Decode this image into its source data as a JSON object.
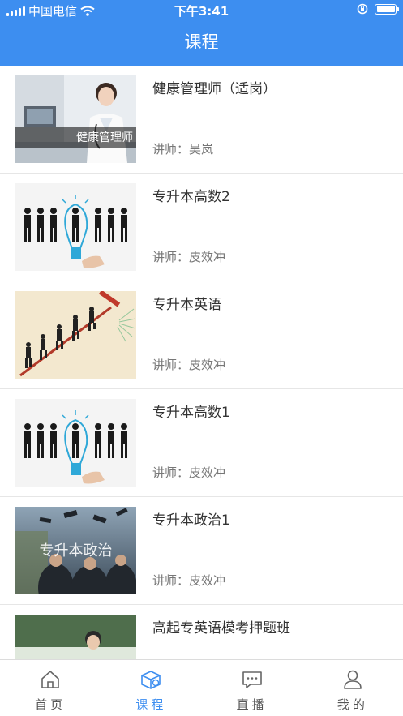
{
  "status_bar": {
    "carrier": "中国电信",
    "time": "下午3:41"
  },
  "header": {
    "title": "课程"
  },
  "courses": [
    {
      "title": "健康管理师（适岗）",
      "teacher": "讲师：吴岚",
      "thumb_caption": "健康管理师"
    },
    {
      "title": "专升本高数2",
      "teacher": "讲师：皮效冲"
    },
    {
      "title": "专升本英语",
      "teacher": "讲师：皮效冲"
    },
    {
      "title": "专升本高数1",
      "teacher": "讲师：皮效冲"
    },
    {
      "title": "专升本政治1",
      "teacher": "讲师：皮效冲",
      "thumb_caption": "专升本政治"
    },
    {
      "title": "高起专英语模考押题班",
      "teacher": ""
    }
  ],
  "tabbar": {
    "items": [
      {
        "label": "首页",
        "icon": "home-icon"
      },
      {
        "label": "课程",
        "icon": "course-box-icon"
      },
      {
        "label": "直播",
        "icon": "live-chat-icon"
      },
      {
        "label": "我的",
        "icon": "user-icon"
      }
    ],
    "active_index": 1
  },
  "colors": {
    "accent": "#3d8ef0",
    "title_text": "#333333",
    "sub_text": "#777777"
  }
}
